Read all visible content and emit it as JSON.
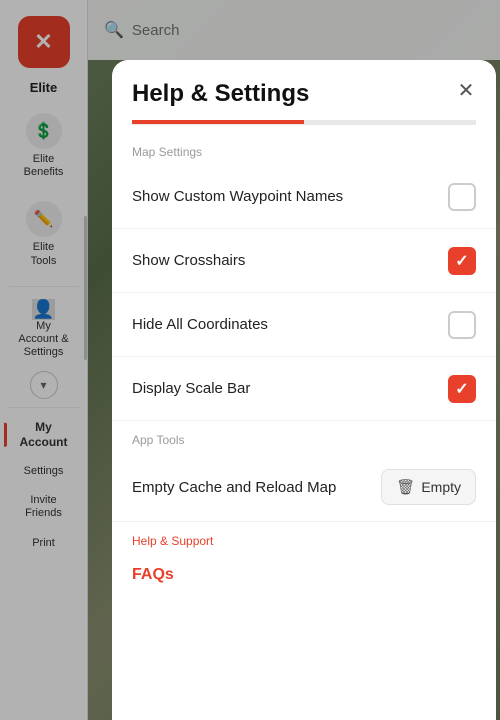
{
  "app": {
    "title": "Help & Settings"
  },
  "map": {
    "bg_color": "#6b7c5e"
  },
  "search": {
    "placeholder": "Search"
  },
  "sidebar": {
    "close_icon": "✕",
    "section_label": "Elite",
    "items": [
      {
        "id": "elite-benefits",
        "icon": "💲",
        "label": "Elite\nBenefits"
      },
      {
        "id": "elite-tools",
        "icon": "✏️",
        "label": "Elite\nTools"
      }
    ],
    "nav_items": [
      {
        "id": "my-account-settings",
        "icon": "👤",
        "label": "My\nAccount &\nSettings",
        "active": false
      },
      {
        "id": "my-account",
        "icon": "👤",
        "label": "My\nAccount",
        "active": true
      },
      {
        "id": "settings",
        "icon": "⚙️",
        "label": "Settings",
        "active": false
      },
      {
        "id": "invite-friends",
        "icon": "👥",
        "label": "Invite\nFriends",
        "active": false
      },
      {
        "id": "print",
        "icon": "🖨️",
        "label": "Print",
        "active": false
      }
    ],
    "chevron_label": "chevron-down"
  },
  "modal": {
    "title": "Help & Settings",
    "close_label": "✕",
    "tabs": [
      {
        "id": "tab-1",
        "active": true
      },
      {
        "id": "tab-2",
        "active": false
      }
    ],
    "sections": [
      {
        "id": "map-settings",
        "label": "Map Settings",
        "label_color": "#999",
        "items": [
          {
            "id": "show-custom-waypoint-names",
            "label": "Show Custom Waypoint Names",
            "checked": false
          },
          {
            "id": "show-crosshairs",
            "label": "Show Crosshairs",
            "checked": true
          },
          {
            "id": "hide-all-coordinates",
            "label": "Hide All Coordinates",
            "checked": false
          },
          {
            "id": "display-scale-bar",
            "label": "Display Scale Bar",
            "checked": true
          }
        ]
      },
      {
        "id": "app-tools",
        "label": "App Tools",
        "label_color": "#999",
        "items": [
          {
            "id": "empty-cache",
            "label": "Empty Cache and Reload Map",
            "type": "button",
            "button_icon": "🗑",
            "button_label": "Empty"
          }
        ]
      },
      {
        "id": "help-support",
        "label": "Help & Support",
        "label_color": "#e8402a",
        "items": [
          {
            "id": "faqs",
            "label": "FAQs",
            "type": "link"
          }
        ]
      }
    ]
  }
}
